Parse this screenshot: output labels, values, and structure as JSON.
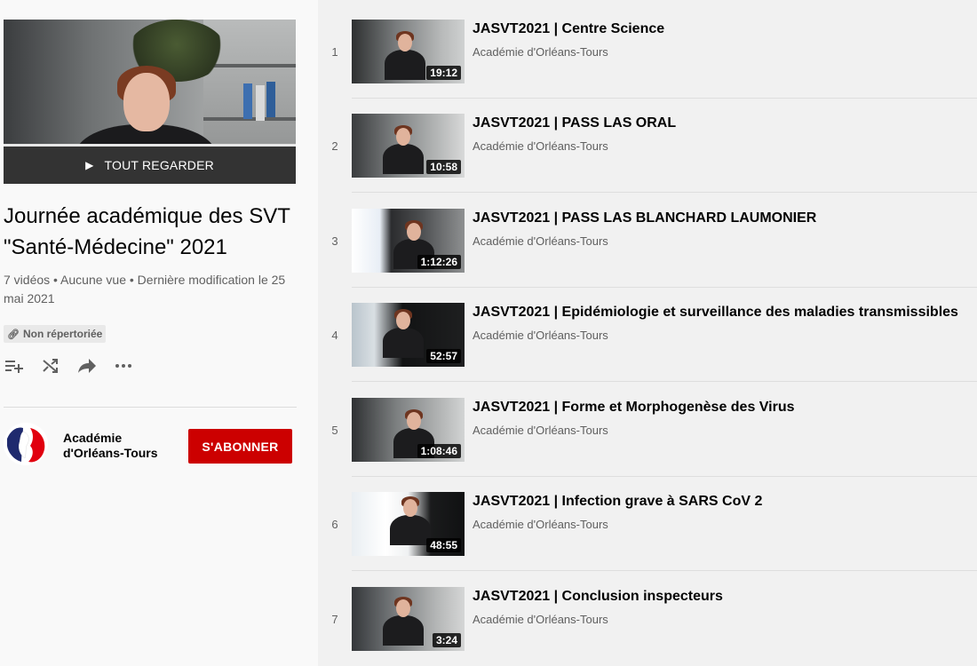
{
  "hero": {
    "watch_all_label": "TOUT REGARDER",
    "play_icon": "play-icon"
  },
  "playlist": {
    "title": "Journée académique des SVT \"Santé-Médecine\" 2021",
    "stats": "7 vidéos • Aucune vue • Dernière modification le 25 mai 2021",
    "privacy_label": "Non répertoriée"
  },
  "actions": [
    {
      "name": "add-to-queue",
      "icon": "playlist-add-icon"
    },
    {
      "name": "shuffle",
      "icon": "shuffle-icon"
    },
    {
      "name": "share",
      "icon": "share-icon"
    },
    {
      "name": "more",
      "icon": "more-icon"
    }
  ],
  "owner": {
    "name": "Académie d'Orléans-Tours",
    "subscribe_label": "S'ABONNER"
  },
  "colors": {
    "subscribe": "#cc0000",
    "list_bg": "#f1f1f1",
    "sidebar_bg": "#f9f9f9"
  },
  "videos": [
    {
      "index": "1",
      "title": "JASVT2021 | Centre Science",
      "channel": "Académie d'Orléans-Tours",
      "duration": "19:12"
    },
    {
      "index": "2",
      "title": "JASVT2021 | PASS LAS ORAL",
      "channel": "Académie d'Orléans-Tours",
      "duration": "10:58"
    },
    {
      "index": "3",
      "title": "JASVT2021 | PASS LAS BLANCHARD LAUMONIER",
      "channel": "Académie d'Orléans-Tours",
      "duration": "1:12:26"
    },
    {
      "index": "4",
      "title": "JASVT2021 | Epidémiologie et surveillance des maladies transmissibles",
      "channel": "Académie d'Orléans-Tours",
      "duration": "52:57"
    },
    {
      "index": "5",
      "title": "JASVT2021 | Forme et Morphogenèse des Virus",
      "channel": "Académie d'Orléans-Tours",
      "duration": "1:08:46"
    },
    {
      "index": "6",
      "title": "JASVT2021 | Infection grave à SARS CoV 2",
      "channel": "Académie d'Orléans-Tours",
      "duration": "48:55"
    },
    {
      "index": "7",
      "title": "JASVT2021 | Conclusion inspecteurs",
      "channel": "Académie d'Orléans-Tours",
      "duration": "3:24"
    }
  ]
}
